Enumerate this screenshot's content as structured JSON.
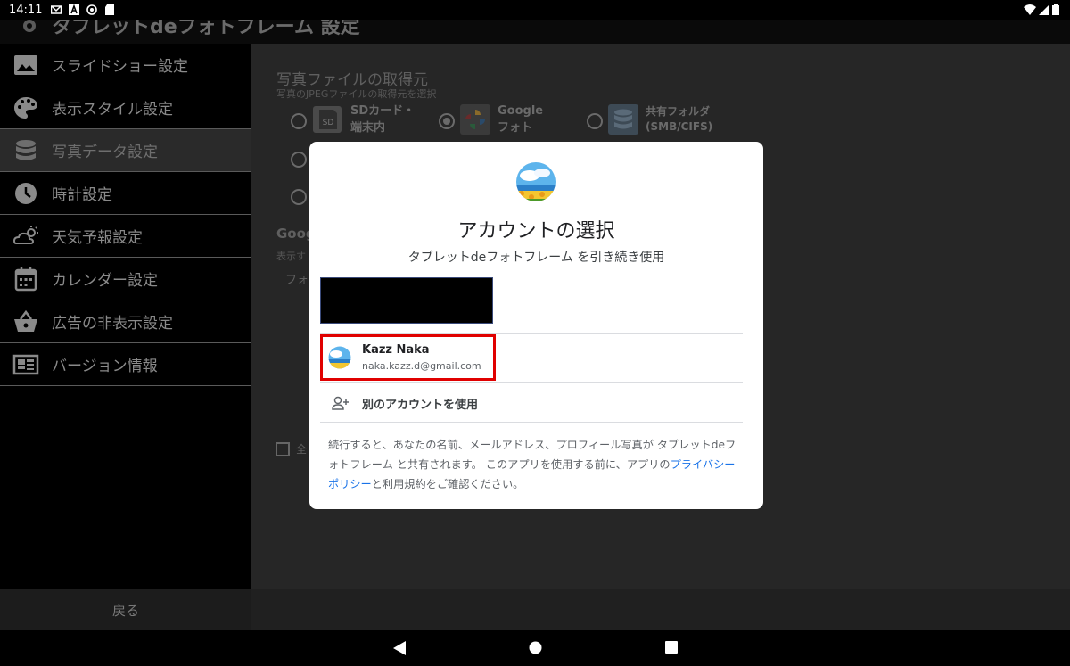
{
  "status_bar": {
    "time": "14:11",
    "icons": [
      "gmail-icon",
      "a-icon",
      "sync-icon",
      "sdcard-icon"
    ],
    "right_icons": [
      "wifi-icon",
      "signal-icon",
      "battery-icon"
    ]
  },
  "app_header": {
    "title": "タブレットdeフォトフレーム 設定"
  },
  "sidebar": {
    "items": [
      {
        "label": "スライドショー設定",
        "icon": "image-icon"
      },
      {
        "label": "表示スタイル設定",
        "icon": "palette-icon"
      },
      {
        "label": "写真データ設定",
        "icon": "database-icon",
        "active": true
      },
      {
        "label": "時計設定",
        "icon": "clock-icon"
      },
      {
        "label": "天気予報設定",
        "icon": "weather-icon"
      },
      {
        "label": "カレンダー設定",
        "icon": "calendar-icon"
      },
      {
        "label": "広告の非表示設定",
        "icon": "basket-icon"
      },
      {
        "label": "バージョン情報",
        "icon": "news-icon"
      }
    ],
    "back_label": "戻る"
  },
  "panel": {
    "section_title": "写真ファイルの取得元",
    "section_sub": "写真のJPEGファイルの取得元を選択",
    "sources": [
      {
        "label_line1": "SDカード・",
        "label_line2": "端末内",
        "icon": "sdcard-icon",
        "selected": false
      },
      {
        "label_line1": "Google",
        "label_line2": "フォト",
        "icon": "google-photos-icon",
        "selected": true
      },
      {
        "label_line1": "共有フォルダ",
        "label_line2": "(SMB/CIFS)",
        "icon": "storage-icon",
        "selected": false
      }
    ],
    "google_title": "Goog",
    "show_text": "表示す",
    "photo_text": "フォ",
    "checkbox_text": "全"
  },
  "dialog": {
    "title": "アカウントの選択",
    "subtitle": "タブレットdeフォトフレーム を引き続き使用",
    "account": {
      "name": "Kazz Naka",
      "email": "naka.kazz.d@gmail.com"
    },
    "other_account": "別のアカウントを使用",
    "note_part1": "続行すると、あなたの名前、メールアドレス、プロフィール写真が タブレットdeフォトフレーム と共有されます。 このアプリを使用する前に、アプリの",
    "note_link": "プライバシー ポリシー",
    "note_part2": "と利用規約をご確認ください。"
  },
  "navbar": {
    "buttons": [
      "back-icon",
      "home-icon",
      "recents-icon"
    ]
  }
}
